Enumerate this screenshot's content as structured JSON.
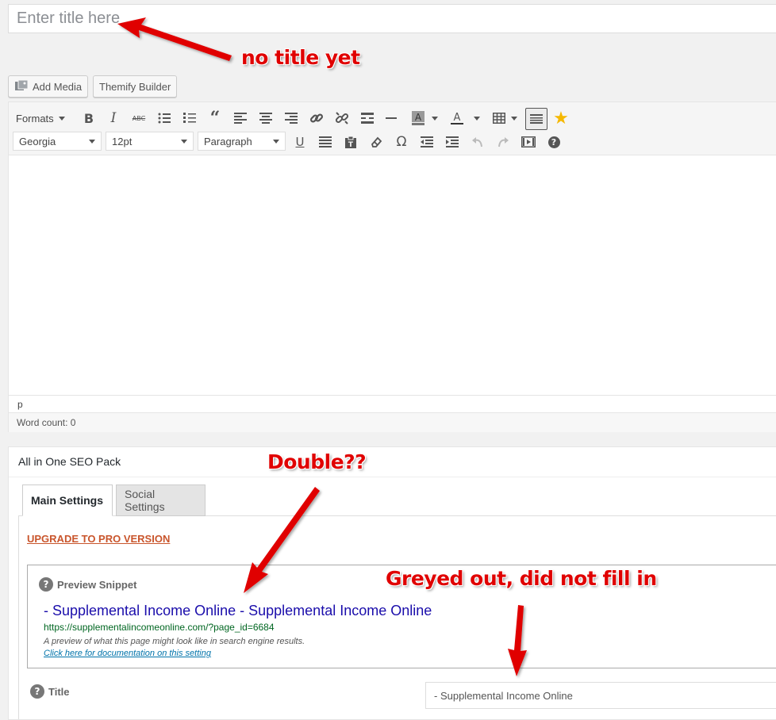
{
  "editor_title": {
    "placeholder": "Enter title here"
  },
  "media_buttons": {
    "add_media": "Add Media",
    "themify_builder": "Themify Builder"
  },
  "toolbar": {
    "formats_label": "Formats",
    "font_family": "Georgia",
    "font_size": "12pt",
    "block_format": "Paragraph",
    "icons": [
      "bold-icon",
      "italic-icon",
      "strikethrough-icon",
      "bullet-list-icon",
      "numbered-list-icon",
      "blockquote-icon",
      "align-left-icon",
      "align-center-icon",
      "align-right-icon",
      "link-icon",
      "unlink-icon",
      "read-more-icon",
      "horizontal-line-icon",
      "background-color-icon",
      "text-color-icon",
      "table-icon",
      "toolbar-toggle-icon",
      "star-icon",
      "underline-icon",
      "justify-icon",
      "paste-text-icon",
      "clear-formatting-icon",
      "special-character-icon",
      "outdent-icon",
      "indent-icon",
      "undo-icon",
      "redo-icon",
      "media-icon",
      "help-icon"
    ]
  },
  "editor": {
    "path": "p",
    "word_count": "Word count: 0"
  },
  "seo": {
    "box_title": "All in One SEO Pack",
    "tabs": [
      "Main Settings",
      "Social Settings"
    ],
    "upgrade_link": "UPGRADE TO PRO VERSION",
    "preview_label": "Preview Snippet",
    "snippet_title": "- Supplemental Income Online - Supplemental Income Online",
    "snippet_url": "https://supplementalincomeonline.com/?page_id=6684",
    "snippet_description": "A preview of what this page might look like in search engine results.",
    "snippet_doc_link": "Click here for documentation on this setting",
    "title_label": "Title",
    "title_field_placeholder": "- Supplemental Income Online"
  },
  "annotations": {
    "no_title": "no title yet",
    "double": "Double??",
    "greyed_out": "Greyed out, did not fill in",
    "color": "#e00000"
  }
}
